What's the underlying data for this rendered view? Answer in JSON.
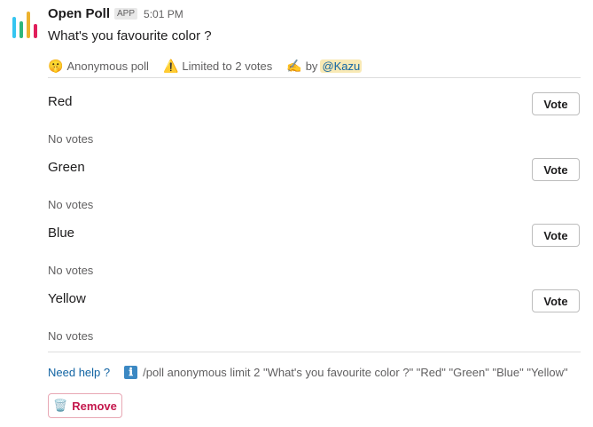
{
  "app": {
    "name": "Open Poll",
    "badge": "APP",
    "timestamp": "5:01 PM",
    "logo_colors": [
      "#36c5f0",
      "#2eb67d",
      "#ecb22e",
      "#e01e5a"
    ]
  },
  "poll": {
    "question": "What's you favourite color ?",
    "meta": {
      "anonymous_emoji": "🤫",
      "anonymous_label": "Anonymous poll",
      "limit_emoji": "⚠️",
      "limit_label": "Limited to 2 votes",
      "author_emoji": "✍️",
      "by_label": "by",
      "author_mention": "@Kazu"
    },
    "options": [
      {
        "label": "Red",
        "button": "Vote",
        "votes": "No votes"
      },
      {
        "label": "Green",
        "button": "Vote",
        "votes": "No votes"
      },
      {
        "label": "Blue",
        "button": "Vote",
        "votes": "No votes"
      },
      {
        "label": "Yellow",
        "button": "Vote",
        "votes": "No votes"
      }
    ],
    "help_link": "Need help ?",
    "info_icon": "ℹ",
    "command": "/poll anonymous limit 2 \"What's you favourite color ?\" \"Red\" \"Green\" \"Blue\" \"Yellow\"",
    "remove_icon": "🗑️",
    "remove_label": "Remove"
  }
}
